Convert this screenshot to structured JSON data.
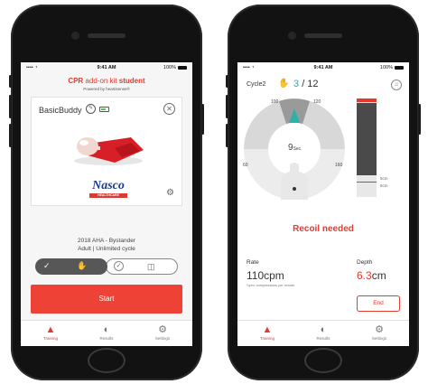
{
  "status": {
    "time": "9:41 AM",
    "battery": "100%",
    "signal": "•••• ◔"
  },
  "left": {
    "brand": {
      "part1": "CPR",
      "part2": " add-on kit ",
      "part3": "student"
    },
    "powered": "Powered by heartisense®",
    "device": {
      "name": "BasicBuddy",
      "logo_text": "Nasco",
      "logo_sub": "HEALTHCARE"
    },
    "protocol": {
      "line1": "2018 AHA - Bystander",
      "line2": "Adult | Unlimited cycle"
    },
    "start_label": "Start"
  },
  "right": {
    "cycle": "Cycle2",
    "count_current": "3",
    "count_total": "/ 12",
    "gauge": {
      "label_100": "100",
      "label_120": "120",
      "label_60": "60",
      "label_160": "160",
      "seconds": "9",
      "seconds_unit": "Sec."
    },
    "depth_marks": {
      "top": "5cm",
      "bottom": "6cm"
    },
    "message": "Recoil needed",
    "rate": {
      "label": "Rate",
      "value": "110cpm",
      "note": "*cpm: compressions per minute"
    },
    "depth": {
      "label": "Depth",
      "value": "6.3",
      "unit": "cm"
    },
    "end_label": "End"
  },
  "tabs": [
    {
      "label": "Training",
      "icon": "training-icon"
    },
    {
      "label": "Results",
      "icon": "results-icon"
    },
    {
      "label": "Settings",
      "icon": "settings-icon"
    }
  ],
  "colors": {
    "accent": "#ef4236",
    "teal": "#2ab3a6",
    "dark": "#4a4a4a"
  }
}
